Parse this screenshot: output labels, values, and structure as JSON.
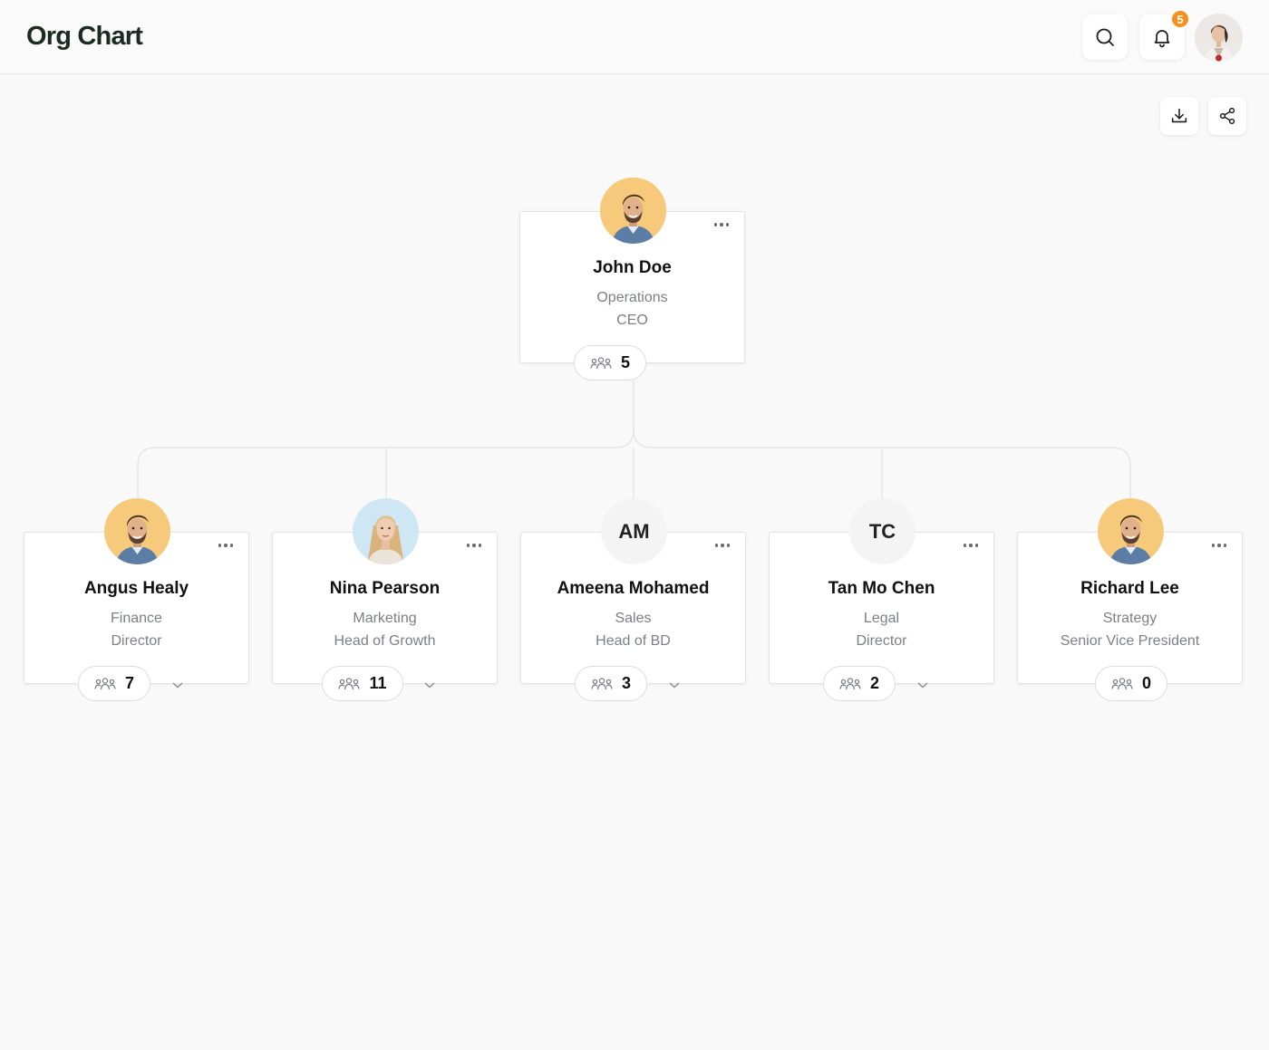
{
  "app": {
    "title": "Org Chart"
  },
  "header": {
    "notification_count": "5"
  },
  "ceo": {
    "name": "John Doe",
    "department": "Operations",
    "role": "CEO",
    "reports": "5"
  },
  "members": [
    {
      "name": "Angus Healy",
      "department": "Finance",
      "role": "Director",
      "reports": "7",
      "avatar": "photo-man",
      "initials": ""
    },
    {
      "name": "Nina Pearson",
      "department": "Marketing",
      "role": "Head of Growth",
      "reports": "11",
      "avatar": "photo-woman",
      "initials": ""
    },
    {
      "name": "Ameena Mohamed",
      "department": "Sales",
      "role": "Head of BD",
      "reports": "3",
      "avatar": "initials",
      "initials": "AM"
    },
    {
      "name": "Tan Mo Chen",
      "department": "Legal",
      "role": "Director",
      "reports": "2",
      "avatar": "initials",
      "initials": "TC"
    },
    {
      "name": "Richard Lee",
      "department": "Strategy",
      "role": "Senior Vice President",
      "reports": "0",
      "avatar": "photo-man",
      "initials": ""
    }
  ],
  "icons": [
    "search-icon",
    "bell-icon",
    "download-icon",
    "share-icon",
    "more-icon",
    "team-icon",
    "chevron-down-icon"
  ],
  "colors": {
    "accent": "#f5901c",
    "logo": "#1c2b20",
    "avatar_man_bg": "#f7c97a",
    "avatar_woman_bg": "#cfe6f5"
  }
}
